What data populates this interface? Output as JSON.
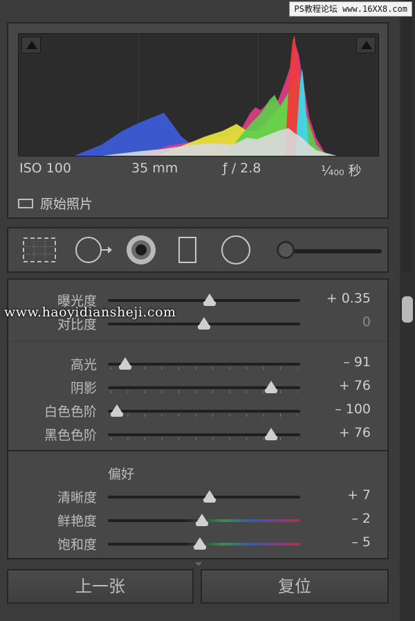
{
  "watermarks": {
    "top": "PS教程论坛 www.16XX8.com",
    "middle": "www.haoyidiansheji.com"
  },
  "histogram": {
    "exif": {
      "iso": "ISO 100",
      "focal": "35 mm",
      "aperture": "ƒ / 2.8",
      "shutter": "¹⁄₄₀₀ 秒"
    },
    "original_photo_label": "原始照片",
    "clip_left_icon": "shadow-clipping-triangle",
    "clip_right_icon": "highlight-clipping-triangle"
  },
  "tools": [
    {
      "name": "crop-overlay-icon"
    },
    {
      "name": "spot-removal-icon"
    },
    {
      "name": "red-eye-icon"
    },
    {
      "name": "graduated-filter-icon"
    },
    {
      "name": "radial-filter-icon"
    },
    {
      "name": "adjustment-brush-icon"
    }
  ],
  "basic": {
    "tone": [
      {
        "label": "曝光度",
        "value": "+ 0.35",
        "pos": 0.53
      },
      {
        "label": "对比度",
        "value": "0",
        "pos": 0.5,
        "dim": true
      }
    ],
    "presence_top": [
      {
        "label": "高光",
        "value": "– 91",
        "pos": 0.09
      },
      {
        "label": "阴影",
        "value": "+ 76",
        "pos": 0.85
      },
      {
        "label": "白色色阶",
        "value": "– 100",
        "pos": 0.04
      },
      {
        "label": "黑色色阶",
        "value": "+ 76",
        "pos": 0.85
      }
    ],
    "preference_title": "偏好",
    "presence": [
      {
        "label": "清晰度",
        "value": "+ 7",
        "pos": 0.53
      },
      {
        "label": "鲜艳度",
        "value": "– 2",
        "pos": 0.49
      },
      {
        "label": "饱和度",
        "value": "– 5",
        "pos": 0.48
      }
    ]
  },
  "buttons": {
    "previous": "上一张",
    "reset": "复位"
  }
}
